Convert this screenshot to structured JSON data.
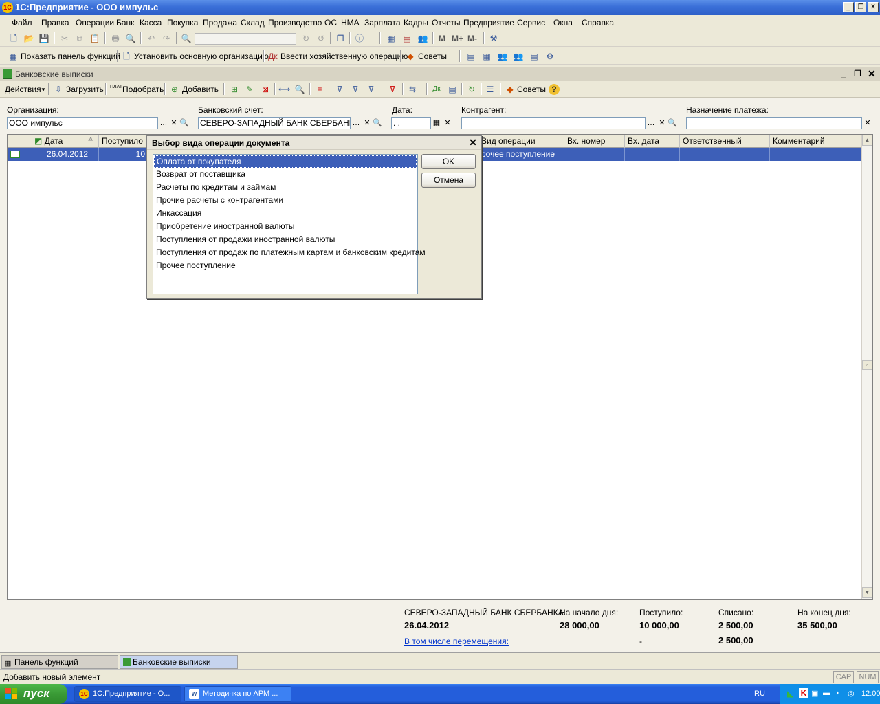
{
  "app": {
    "title": "1С:Предприятие - ООО импульс"
  },
  "menu": [
    "Файл",
    "Правка",
    "Операции",
    "Банк",
    "Касса",
    "Покупка",
    "Продажа",
    "Склад",
    "Производство",
    "ОС",
    "НМА",
    "Зарплата",
    "Кадры",
    "Отчеты",
    "Предприятие",
    "Сервис",
    "Окна",
    "Справка"
  ],
  "toolbar2": {
    "show_panel": "Показать панель функций",
    "set_org": "Установить основную организацию",
    "enter_op": "Ввести хозяйственную операцию",
    "tips": "Советы"
  },
  "doc": {
    "title": "Банковские выписки",
    "actions": "Действия",
    "load": "Загрузить",
    "pick": "Подобрать",
    "add": "Добавить",
    "tips": "Советы",
    "pick_icon_label": "ПЛАТ"
  },
  "filters": {
    "org_label": "Организация:",
    "org_value": "ООО импульс",
    "account_label": "Банковский счет:",
    "account_value": "СЕВЕРО-ЗАПАДНЫЙ БАНК СБЕРБАНКА Р",
    "date_label": "Дата:",
    "date_value": ". .",
    "contractor_label": "Контрагент:",
    "contractor_value": "",
    "purpose_label": "Назначение платежа:",
    "purpose_value": ""
  },
  "grid": {
    "columns": [
      "Дата",
      "Поступило",
      "",
      "Вид операции",
      "Вх. номер",
      "Вх. дата",
      "Ответственный",
      "Комментарий"
    ],
    "rows": [
      {
        "date": "26.04.2012",
        "received": "10",
        "op_type": "рочее поступление"
      }
    ]
  },
  "summary": {
    "bank": "СЕВЕРО-ЗАПАДНЫЙ БАНК СБЕРБАНКА...",
    "date": "26.04.2012",
    "start_label": "На начало дня:",
    "start_value": "28 000,00",
    "in_label": "Поступило:",
    "in_value": "10 000,00",
    "out_label": "Списано:",
    "out_value": "2 500,00",
    "end_label": "На конец дня:",
    "end_value": "35 500,00",
    "transfers_link": "В том числе перемещения:",
    "transfers_in": "-",
    "transfers_out": "2 500,00"
  },
  "tabs": [
    "Панель функций",
    "Банковские выписки"
  ],
  "status": {
    "text": "Добавить новый элемент",
    "cap": "CAP",
    "num": "NUM"
  },
  "dialog": {
    "title": "Выбор вида операции документа",
    "items": [
      "Оплата от покупателя",
      "Возврат от поставщика",
      "Расчеты по кредитам и займам",
      "Прочие расчеты с контрагентами",
      "Инкассация",
      "Приобретение иностранной валюты",
      "Поступления от продажи иностранной валюты",
      "Поступления от продаж по платежным картам и банковским кредитам",
      "Прочее поступление"
    ],
    "selected_index": 0,
    "ok": "OK",
    "cancel": "Отмена"
  },
  "taskbar": {
    "start": "пуск",
    "items": [
      "1С:Предприятие - О...",
      "Методичка по АРМ ..."
    ],
    "lang": "RU",
    "clock": "12:00"
  },
  "colors": {
    "selection": "#3D5FB8",
    "title_bar": "#2E5FC8",
    "taskbar": "#245EDB",
    "start": "#3A9A36"
  }
}
